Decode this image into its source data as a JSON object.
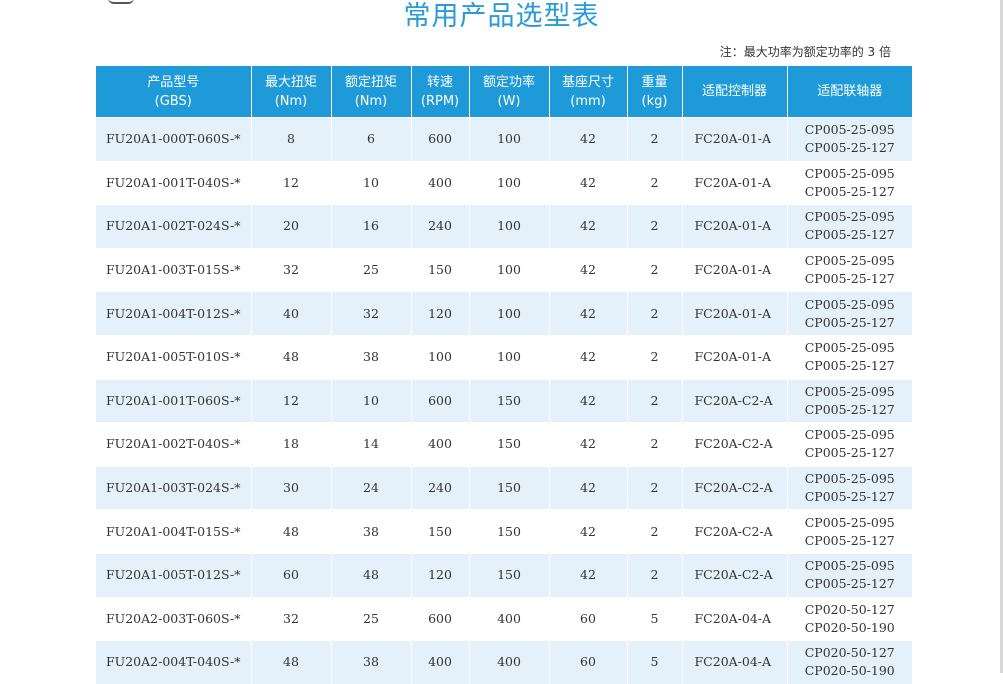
{
  "title": "常用产品选型表",
  "note": "注：最大功率为额定功率的 3 倍",
  "columns": [
    {
      "label": "产品型号",
      "unit": "(GBS)"
    },
    {
      "label": "最大扭矩",
      "unit": "(Nm)"
    },
    {
      "label": "额定扭矩",
      "unit": "(Nm)"
    },
    {
      "label": "转速",
      "unit": "(RPM)"
    },
    {
      "label": "额定功率",
      "unit": "(W)"
    },
    {
      "label": "基座尺寸",
      "unit": "(mm)"
    },
    {
      "label": "重量",
      "unit": "(kg)"
    },
    {
      "label": "适配控制器",
      "unit": ""
    },
    {
      "label": "适配联轴器",
      "unit": ""
    }
  ],
  "rows": [
    [
      "FU20A1-000T-060S-*",
      "8",
      "6",
      "600",
      "100",
      "42",
      "2",
      "FC20A-01-A",
      "CP005-25-095",
      "CP005-25-127"
    ],
    [
      "FU20A1-001T-040S-*",
      "12",
      "10",
      "400",
      "100",
      "42",
      "2",
      "FC20A-01-A",
      "CP005-25-095",
      "CP005-25-127"
    ],
    [
      "FU20A1-002T-024S-*",
      "20",
      "16",
      "240",
      "100",
      "42",
      "2",
      "FC20A-01-A",
      "CP005-25-095",
      "CP005-25-127"
    ],
    [
      "FU20A1-003T-015S-*",
      "32",
      "25",
      "150",
      "100",
      "42",
      "2",
      "FC20A-01-A",
      "CP005-25-095",
      "CP005-25-127"
    ],
    [
      "FU20A1-004T-012S-*",
      "40",
      "32",
      "120",
      "100",
      "42",
      "2",
      "FC20A-01-A",
      "CP005-25-095",
      "CP005-25-127"
    ],
    [
      "FU20A1-005T-010S-*",
      "48",
      "38",
      "100",
      "100",
      "42",
      "2",
      "FC20A-01-A",
      "CP005-25-095",
      "CP005-25-127"
    ],
    [
      "FU20A1-001T-060S-*",
      "12",
      "10",
      "600",
      "150",
      "42",
      "2",
      "FC20A-C2-A",
      "CP005-25-095",
      "CP005-25-127"
    ],
    [
      "FU20A1-002T-040S-*",
      "18",
      "14",
      "400",
      "150",
      "42",
      "2",
      "FC20A-C2-A",
      "CP005-25-095",
      "CP005-25-127"
    ],
    [
      "FU20A1-003T-024S-*",
      "30",
      "24",
      "240",
      "150",
      "42",
      "2",
      "FC20A-C2-A",
      "CP005-25-095",
      "CP005-25-127"
    ],
    [
      "FU20A1-004T-015S-*",
      "48",
      "38",
      "150",
      "150",
      "42",
      "2",
      "FC20A-C2-A",
      "CP005-25-095",
      "CP005-25-127"
    ],
    [
      "FU20A1-005T-012S-*",
      "60",
      "48",
      "120",
      "150",
      "42",
      "2",
      "FC20A-C2-A",
      "CP005-25-095",
      "CP005-25-127"
    ],
    [
      "FU20A2-003T-060S-*",
      "32",
      "25",
      "600",
      "400",
      "60",
      "5",
      "FC20A-04-A",
      "CP020-50-127",
      "CP020-50-190"
    ],
    [
      "FU20A2-004T-040S-*",
      "48",
      "38",
      "400",
      "400",
      "60",
      "5",
      "FC20A-04-A",
      "CP020-50-127",
      "CP020-50-190"
    ]
  ]
}
